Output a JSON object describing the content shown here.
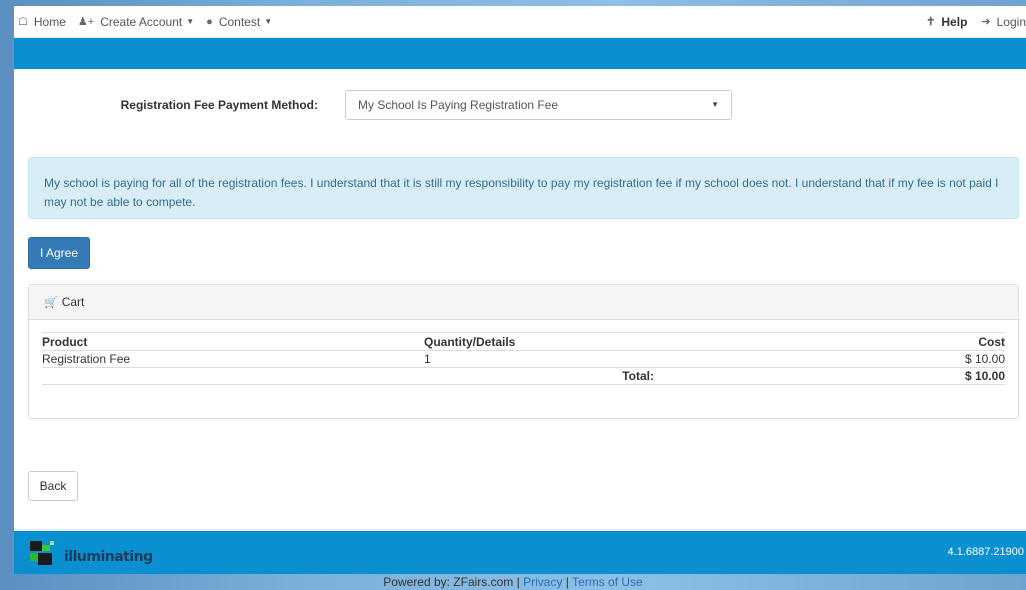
{
  "nav": {
    "home": "Home",
    "create_account": "Create Account",
    "contest": "Contest",
    "help": "Help",
    "login": "Login"
  },
  "form": {
    "method_label": "Registration Fee Payment Method:",
    "method_value": "My School Is Paying Registration Fee"
  },
  "info_text": "My school is paying for all of the registration fees. I understand that it is still my responsibility to pay my registration fee if my school does not. I understand that if my fee is not paid I may not be able to compete.",
  "agree_label": "I Agree",
  "cart": {
    "title": "Cart",
    "headers": [
      "Product",
      "Quantity/Details",
      "Cost"
    ],
    "rows": [
      {
        "product": "Registration Fee",
        "qty": "1",
        "cost": "$ 10.00"
      }
    ],
    "total_label": "Total:",
    "total_value": "$ 10.00"
  },
  "back_label": "Back",
  "footer": {
    "logo_text": "illuminating",
    "version": "4.1.6887.21900",
    "powered": "Powered by: ZFairs.com |",
    "privacy": "Privacy",
    "sep": "|",
    "terms": "Terms of Use"
  },
  "colors": {
    "primary_bar": "#0a8fd0",
    "button_primary": "#337ab7",
    "info_bg": "#d9edf7",
    "info_text": "#31708f"
  }
}
